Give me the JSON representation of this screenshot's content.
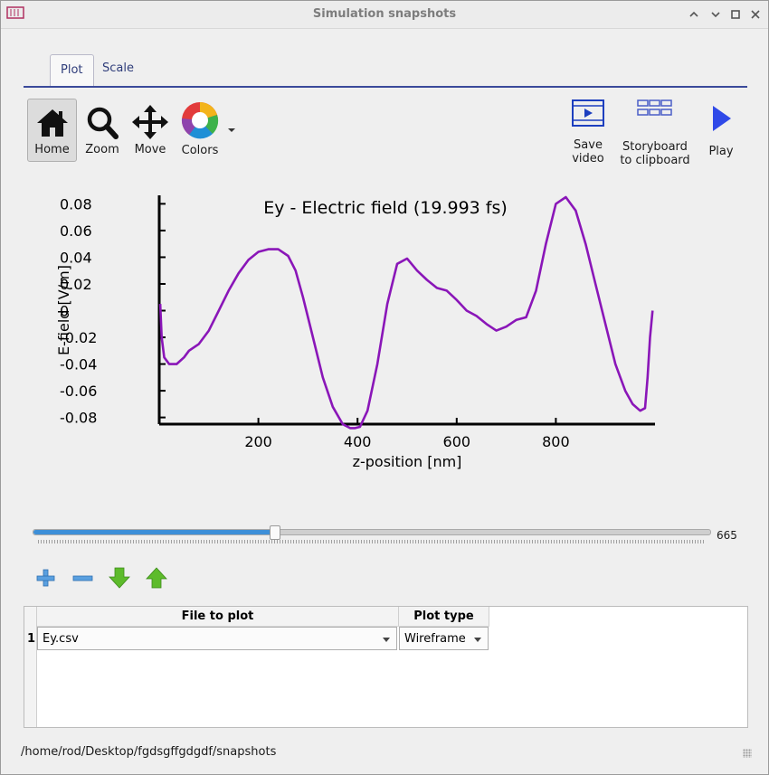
{
  "window": {
    "title": "Simulation snapshots",
    "controls": [
      "chevron-up-icon",
      "minimize-icon",
      "maximize-icon",
      "close-icon"
    ]
  },
  "tabs": [
    {
      "label": "Plot",
      "active": true
    },
    {
      "label": "Scale",
      "active": false
    }
  ],
  "toolbar": {
    "home": "Home",
    "zoom": "Zoom",
    "move": "Move",
    "colors": "Colors",
    "save_video": [
      "Save",
      "video"
    ],
    "storyboard": [
      "Storyboard",
      "to clipboard"
    ],
    "play": "Play"
  },
  "chart_data": {
    "type": "line",
    "title": "Ey - Electric field (19.993 fs)",
    "xlabel": "z-position [nm]",
    "ylabel": "E-field [V/m]",
    "xlim": [
      0,
      1000
    ],
    "ylim": [
      -0.085,
      0.085
    ],
    "xticks": [
      "200",
      "400",
      "600",
      "800"
    ],
    "yticks": [
      "0.08",
      "0.06",
      "0.04",
      "0.02",
      "0",
      "-0.02",
      "-0.04",
      "-0.06",
      "-0.08"
    ],
    "color": "#8a16b8",
    "series": [
      {
        "x": [
          2,
          5,
          10,
          20,
          35,
          50,
          60,
          80,
          100,
          120,
          140,
          160,
          180,
          200,
          220,
          240,
          260,
          275,
          290,
          310,
          330,
          350,
          370,
          385,
          395,
          405,
          420,
          440,
          460,
          480,
          500,
          520,
          540,
          560,
          580,
          600,
          620,
          640,
          660,
          680,
          700,
          720,
          740,
          760,
          780,
          800,
          820,
          840,
          860,
          880,
          900,
          920,
          940,
          955,
          970,
          980,
          985,
          990,
          995
        ],
        "y": [
          0.005,
          -0.02,
          -0.035,
          -0.04,
          -0.04,
          -0.035,
          -0.03,
          -0.025,
          -0.015,
          0.0,
          0.015,
          0.028,
          0.038,
          0.044,
          0.046,
          0.046,
          0.041,
          0.03,
          0.01,
          -0.02,
          -0.05,
          -0.072,
          -0.085,
          -0.088,
          -0.088,
          -0.087,
          -0.075,
          -0.04,
          0.005,
          0.035,
          0.039,
          0.03,
          0.023,
          0.017,
          0.015,
          0.008,
          0.0,
          -0.004,
          -0.01,
          -0.015,
          -0.012,
          -0.007,
          -0.005,
          0.015,
          0.05,
          0.08,
          0.085,
          0.075,
          0.05,
          0.02,
          -0.01,
          -0.04,
          -0.06,
          -0.07,
          -0.075,
          -0.073,
          -0.05,
          -0.02,
          0.0
        ]
      }
    ]
  },
  "slider": {
    "value": "665",
    "fraction": 0.355
  },
  "action_icons": [
    "add-icon",
    "remove-icon",
    "move-down-icon",
    "move-up-icon"
  ],
  "table": {
    "headers": [
      "File to plot",
      "Plot type"
    ],
    "rows": [
      {
        "num": "1",
        "file": "Ey.csv",
        "type": "Wireframe"
      }
    ]
  },
  "status": "/home/rod/Desktop/fgdsgffgdgdf/snapshots"
}
